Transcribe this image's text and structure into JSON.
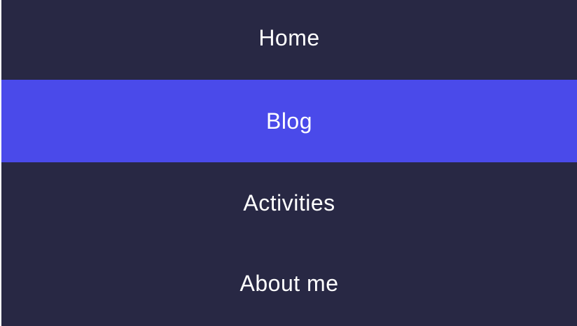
{
  "nav": {
    "items": [
      {
        "label": "Home",
        "active": false
      },
      {
        "label": "Blog",
        "active": true
      },
      {
        "label": "Activities",
        "active": false
      },
      {
        "label": "About me",
        "active": false
      }
    ]
  },
  "colors": {
    "background": "#282844",
    "active": "#4a4aea",
    "text": "#ffffff"
  }
}
